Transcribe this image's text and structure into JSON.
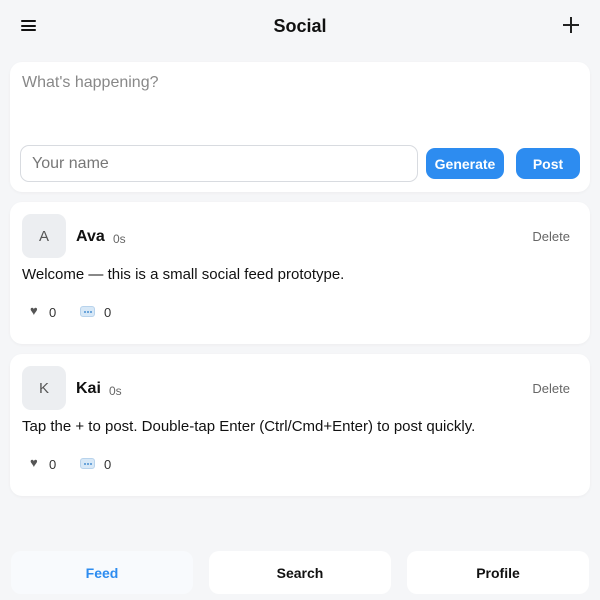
{
  "header": {
    "title": "Social",
    "menu_icon": "menu-icon",
    "add_icon": "plus-icon"
  },
  "compose": {
    "text_placeholder": "What's happening?",
    "name_placeholder": "Your name",
    "generate_label": "Generate",
    "post_label": "Post"
  },
  "posts": [
    {
      "avatar": "A",
      "author": "Ava",
      "time": "0s",
      "delete_label": "Delete",
      "text": "Welcome — this is a small social feed prototype.",
      "likes": "0",
      "comments": "0"
    },
    {
      "avatar": "K",
      "author": "Kai",
      "time": "0s",
      "delete_label": "Delete",
      "text": "Tap the + to post. Double-tap Enter (Ctrl/Cmd+Enter) to post quickly.",
      "likes": "0",
      "comments": "0"
    }
  ],
  "nav": {
    "tabs": [
      {
        "label": "Feed",
        "active": true
      },
      {
        "label": "Search",
        "active": false
      },
      {
        "label": "Profile",
        "active": false
      }
    ]
  },
  "colors": {
    "accent": "#2d8cf0",
    "background": "#f5f6f8",
    "card": "#ffffff"
  }
}
